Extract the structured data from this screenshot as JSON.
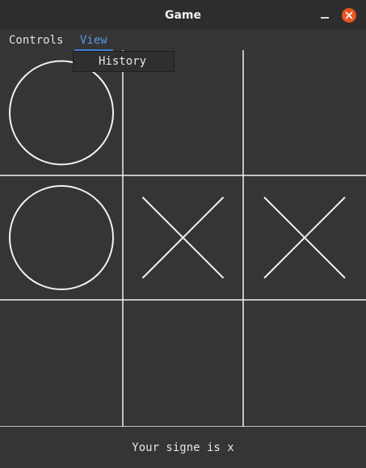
{
  "window": {
    "title": "Game"
  },
  "menu": {
    "items": [
      {
        "label": "Controls"
      },
      {
        "label": "View"
      }
    ],
    "dropdown": {
      "items": [
        {
          "label": "History"
        }
      ]
    }
  },
  "board": {
    "cells": [
      [
        "O",
        "",
        ""
      ],
      [
        "O",
        "X",
        "X"
      ],
      [
        "",
        "",
        ""
      ]
    ]
  },
  "status": {
    "text": "Your signe is x"
  },
  "colors": {
    "background": "#353535",
    "grid": "#f2f2f2",
    "mark": "#f2f2f2",
    "accent": "#3f7fd6",
    "close_button": "#e95420"
  }
}
